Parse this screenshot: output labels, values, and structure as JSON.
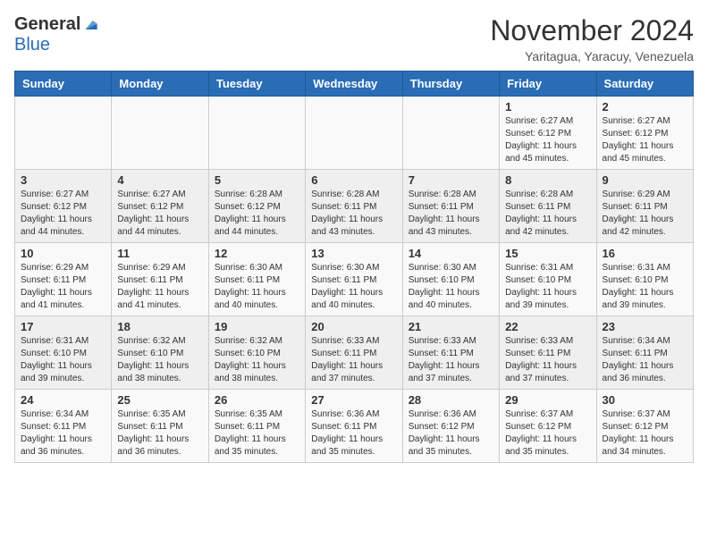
{
  "header": {
    "logo_general": "General",
    "logo_blue": "Blue",
    "month_title": "November 2024",
    "location": "Yaritagua, Yaracuy, Venezuela"
  },
  "weekdays": [
    "Sunday",
    "Monday",
    "Tuesday",
    "Wednesday",
    "Thursday",
    "Friday",
    "Saturday"
  ],
  "weeks": [
    [
      {
        "day": "",
        "info": ""
      },
      {
        "day": "",
        "info": ""
      },
      {
        "day": "",
        "info": ""
      },
      {
        "day": "",
        "info": ""
      },
      {
        "day": "",
        "info": ""
      },
      {
        "day": "1",
        "info": "Sunrise: 6:27 AM\nSunset: 6:12 PM\nDaylight: 11 hours and 45 minutes."
      },
      {
        "day": "2",
        "info": "Sunrise: 6:27 AM\nSunset: 6:12 PM\nDaylight: 11 hours and 45 minutes."
      }
    ],
    [
      {
        "day": "3",
        "info": "Sunrise: 6:27 AM\nSunset: 6:12 PM\nDaylight: 11 hours and 44 minutes."
      },
      {
        "day": "4",
        "info": "Sunrise: 6:27 AM\nSunset: 6:12 PM\nDaylight: 11 hours and 44 minutes."
      },
      {
        "day": "5",
        "info": "Sunrise: 6:28 AM\nSunset: 6:12 PM\nDaylight: 11 hours and 44 minutes."
      },
      {
        "day": "6",
        "info": "Sunrise: 6:28 AM\nSunset: 6:11 PM\nDaylight: 11 hours and 43 minutes."
      },
      {
        "day": "7",
        "info": "Sunrise: 6:28 AM\nSunset: 6:11 PM\nDaylight: 11 hours and 43 minutes."
      },
      {
        "day": "8",
        "info": "Sunrise: 6:28 AM\nSunset: 6:11 PM\nDaylight: 11 hours and 42 minutes."
      },
      {
        "day": "9",
        "info": "Sunrise: 6:29 AM\nSunset: 6:11 PM\nDaylight: 11 hours and 42 minutes."
      }
    ],
    [
      {
        "day": "10",
        "info": "Sunrise: 6:29 AM\nSunset: 6:11 PM\nDaylight: 11 hours and 41 minutes."
      },
      {
        "day": "11",
        "info": "Sunrise: 6:29 AM\nSunset: 6:11 PM\nDaylight: 11 hours and 41 minutes."
      },
      {
        "day": "12",
        "info": "Sunrise: 6:30 AM\nSunset: 6:11 PM\nDaylight: 11 hours and 40 minutes."
      },
      {
        "day": "13",
        "info": "Sunrise: 6:30 AM\nSunset: 6:11 PM\nDaylight: 11 hours and 40 minutes."
      },
      {
        "day": "14",
        "info": "Sunrise: 6:30 AM\nSunset: 6:10 PM\nDaylight: 11 hours and 40 minutes."
      },
      {
        "day": "15",
        "info": "Sunrise: 6:31 AM\nSunset: 6:10 PM\nDaylight: 11 hours and 39 minutes."
      },
      {
        "day": "16",
        "info": "Sunrise: 6:31 AM\nSunset: 6:10 PM\nDaylight: 11 hours and 39 minutes."
      }
    ],
    [
      {
        "day": "17",
        "info": "Sunrise: 6:31 AM\nSunset: 6:10 PM\nDaylight: 11 hours and 39 minutes."
      },
      {
        "day": "18",
        "info": "Sunrise: 6:32 AM\nSunset: 6:10 PM\nDaylight: 11 hours and 38 minutes."
      },
      {
        "day": "19",
        "info": "Sunrise: 6:32 AM\nSunset: 6:10 PM\nDaylight: 11 hours and 38 minutes."
      },
      {
        "day": "20",
        "info": "Sunrise: 6:33 AM\nSunset: 6:11 PM\nDaylight: 11 hours and 37 minutes."
      },
      {
        "day": "21",
        "info": "Sunrise: 6:33 AM\nSunset: 6:11 PM\nDaylight: 11 hours and 37 minutes."
      },
      {
        "day": "22",
        "info": "Sunrise: 6:33 AM\nSunset: 6:11 PM\nDaylight: 11 hours and 37 minutes."
      },
      {
        "day": "23",
        "info": "Sunrise: 6:34 AM\nSunset: 6:11 PM\nDaylight: 11 hours and 36 minutes."
      }
    ],
    [
      {
        "day": "24",
        "info": "Sunrise: 6:34 AM\nSunset: 6:11 PM\nDaylight: 11 hours and 36 minutes."
      },
      {
        "day": "25",
        "info": "Sunrise: 6:35 AM\nSunset: 6:11 PM\nDaylight: 11 hours and 36 minutes."
      },
      {
        "day": "26",
        "info": "Sunrise: 6:35 AM\nSunset: 6:11 PM\nDaylight: 11 hours and 35 minutes."
      },
      {
        "day": "27",
        "info": "Sunrise: 6:36 AM\nSunset: 6:11 PM\nDaylight: 11 hours and 35 minutes."
      },
      {
        "day": "28",
        "info": "Sunrise: 6:36 AM\nSunset: 6:12 PM\nDaylight: 11 hours and 35 minutes."
      },
      {
        "day": "29",
        "info": "Sunrise: 6:37 AM\nSunset: 6:12 PM\nDaylight: 11 hours and 35 minutes."
      },
      {
        "day": "30",
        "info": "Sunrise: 6:37 AM\nSunset: 6:12 PM\nDaylight: 11 hours and 34 minutes."
      }
    ]
  ]
}
